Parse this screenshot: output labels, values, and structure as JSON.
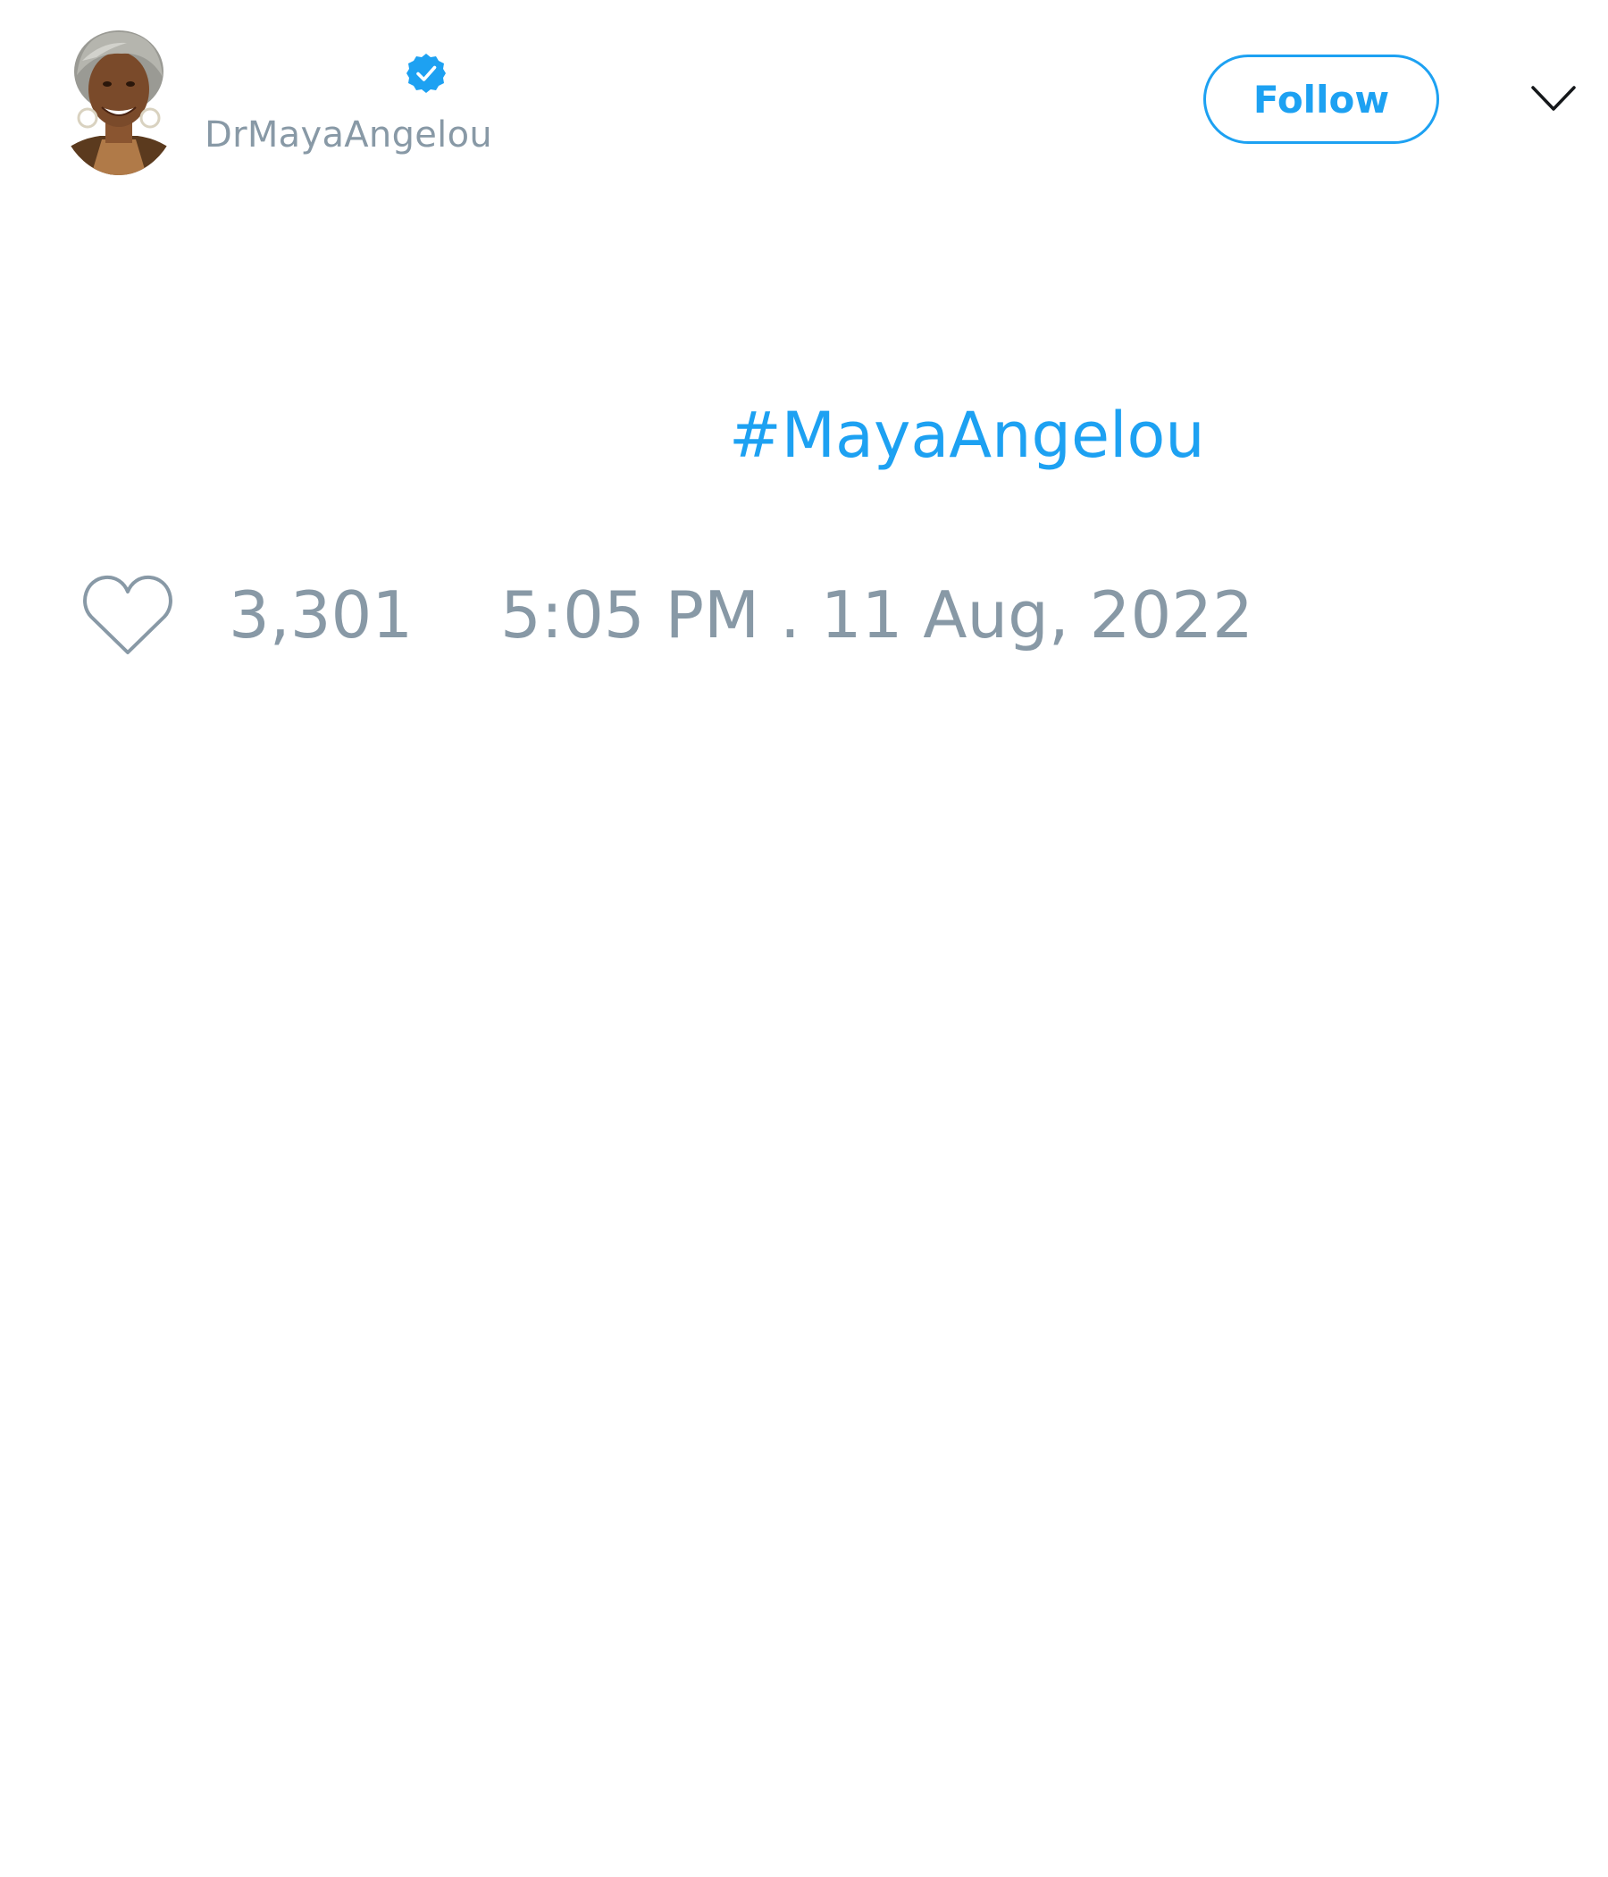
{
  "author": {
    "display_name": "",
    "handle": "DrMayaAngelou",
    "verified": true,
    "avatar_icon": "profile-photo"
  },
  "header": {
    "follow_label": "Follow",
    "menu_icon": "chevron-down-icon"
  },
  "tweet": {
    "text": "",
    "hashtag": "#MayaAngelou"
  },
  "footer": {
    "like_icon": "heart-outline-icon",
    "like_count": "3,301",
    "timestamp": "5:05 PM . 11 Aug, 2022"
  },
  "colors": {
    "accent": "#1da1f2",
    "muted": "#8899a6",
    "text": "#14171a",
    "background": "#ffffff"
  }
}
